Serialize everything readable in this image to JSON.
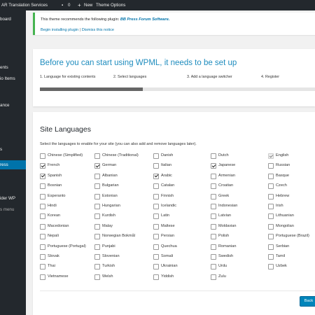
{
  "admin_bar": {
    "site": "AR Translation Services",
    "comments_count": "0",
    "new_label": "New",
    "theme_options": "Theme Options"
  },
  "sidebar": {
    "items": [
      "board",
      "ents",
      "io Items",
      "ance",
      "s",
      "ress",
      "ider WP",
      "s menu"
    ],
    "active_index": 5
  },
  "notice": {
    "text": "This theme recommends the following plugin:",
    "plugin": "BB Press Forum Software.",
    "link_install": "Begin installing plugin",
    "separator": "|",
    "link_dismiss": "Dismiss this notice"
  },
  "wizard": {
    "title": "Before you can start using WPML, it needs to be set up",
    "steps": [
      "1. Language for existing contents",
      "2. Select languages",
      "3. Add a language switcher",
      "4. Register"
    ],
    "progress": 0.375
  },
  "languages_section": {
    "title": "Site Languages",
    "description": "Select the languages to enable for your site (you can also add and remove languages later).",
    "back_label": "Back"
  },
  "languages": [
    [
      "Chinese (Simplified)",
      "Chinese (Traditional)",
      "Danish",
      "Dutch",
      "English"
    ],
    [
      "French",
      "German",
      "Italian",
      "Japanese",
      "Russian"
    ],
    [
      "Spanish",
      "Albanian",
      "Arabic",
      "Armenian",
      "Basque"
    ],
    [
      "Bosnian",
      "Bulgarian",
      "Catalan",
      "Croatian",
      "Czech"
    ],
    [
      "Esperanto",
      "Estonian",
      "Finnish",
      "Greek",
      "Hebrew"
    ],
    [
      "Hindi",
      "Hungarian",
      "Icelandic",
      "Indonesian",
      "Irish"
    ],
    [
      "Korean",
      "Kurdish",
      "Latin",
      "Latvian",
      "Lithuanian"
    ],
    [
      "Macedonian",
      "Malay",
      "Maltese",
      "Moldavian",
      "Mongolian"
    ],
    [
      "Nepali",
      "Norwegian Bokmål",
      "Persian",
      "Polish",
      "Portuguese (Brazil)"
    ],
    [
      "Portuguese (Portugal)",
      "Punjabi",
      "Quechua",
      "Romanian",
      "Serbian"
    ],
    [
      "Slovak",
      "Slovenian",
      "Somali",
      "Swedish",
      "Tamil"
    ],
    [
      "Thai",
      "Turkish",
      "Ukrainian",
      "Urdu",
      "Uzbek"
    ],
    [
      "Vietnamese",
      "Welsh",
      "Yiddish",
      "Zulu"
    ]
  ],
  "checked": [
    "English",
    "French",
    "German",
    "Japanese",
    "Spanish",
    "Arabic"
  ],
  "disabled": [
    "English"
  ],
  "colors": {
    "admin_dark": "#23282d",
    "wp_blue": "#0073aa",
    "notice_green": "#46b450",
    "button_blue": "#0085ba"
  }
}
